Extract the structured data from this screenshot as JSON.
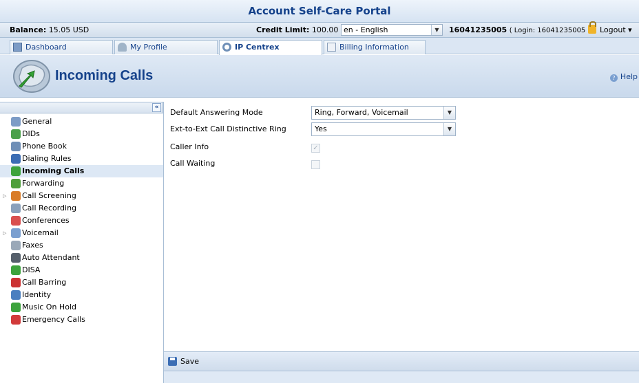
{
  "app": {
    "title": "Account Self-Care Portal"
  },
  "status": {
    "balance_label": "Balance:",
    "balance_value": "15.05 USD",
    "credit_label": "Credit Limit:",
    "credit_value": "100.00 USD",
    "language": "en - English",
    "account_id": "16041235005",
    "login_info": "( Login: 16041235005 )",
    "logout_label": "Logout"
  },
  "tabs": [
    {
      "label": "Dashboard",
      "icon": "dashboard-icon"
    },
    {
      "label": "My Profile",
      "icon": "profile-icon"
    },
    {
      "label": "IP Centrex",
      "icon": "gear-icon",
      "active": true
    },
    {
      "label": "Billing Information",
      "icon": "billing-icon"
    }
  ],
  "header": {
    "title": "Incoming Calls",
    "help_label": "Help"
  },
  "sidebar": {
    "collapse_glyph": "«",
    "items": [
      {
        "label": "General",
        "icon": "gear-icon",
        "color": "#7d9cc6"
      },
      {
        "label": "DIDs",
        "icon": "dids-icon",
        "color": "#4aa04a"
      },
      {
        "label": "Phone Book",
        "icon": "phonebook-icon",
        "color": "#6f8fb7"
      },
      {
        "label": "Dialing Rules",
        "icon": "dialing-rules-icon",
        "color": "#3b6db4"
      },
      {
        "label": "Incoming Calls",
        "icon": "incoming-calls-icon",
        "color": "#3ca33c",
        "active": true
      },
      {
        "label": "Forwarding",
        "icon": "forwarding-icon",
        "color": "#4d9f3a"
      },
      {
        "label": "Call Screening",
        "icon": "call-screening-icon",
        "color": "#d97c28",
        "expandable": true
      },
      {
        "label": "Call Recording",
        "icon": "call-recording-icon",
        "color": "#8aa0bb"
      },
      {
        "label": "Conferences",
        "icon": "conferences-icon",
        "color": "#d94f4f"
      },
      {
        "label": "Voicemail",
        "icon": "voicemail-icon",
        "color": "#7a9fd0",
        "expandable": true
      },
      {
        "label": "Faxes",
        "icon": "fax-icon",
        "color": "#9aa8b8"
      },
      {
        "label": "Auto Attendant",
        "icon": "auto-attendant-icon",
        "color": "#555f6b"
      },
      {
        "label": "DISA",
        "icon": "disa-icon",
        "color": "#3ca33c"
      },
      {
        "label": "Call Barring",
        "icon": "call-barring-icon",
        "color": "#cc3333"
      },
      {
        "label": "Identity",
        "icon": "identity-icon",
        "color": "#4a7fc0"
      },
      {
        "label": "Music On Hold",
        "icon": "music-on-hold-icon",
        "color": "#3ca33c"
      },
      {
        "label": "Emergency Calls",
        "icon": "emergency-calls-icon",
        "color": "#d23a3a"
      }
    ]
  },
  "form": {
    "default_answering_mode": {
      "label": "Default Answering Mode",
      "value": "Ring, Forward, Voicemail"
    },
    "distinctive_ring": {
      "label": "Ext-to-Ext Call Distinctive Ring",
      "value": "Yes"
    },
    "caller_info": {
      "label": "Caller Info",
      "checked": true
    },
    "call_waiting": {
      "label": "Call Waiting",
      "checked": false
    }
  },
  "footer": {
    "save_label": "Save"
  }
}
